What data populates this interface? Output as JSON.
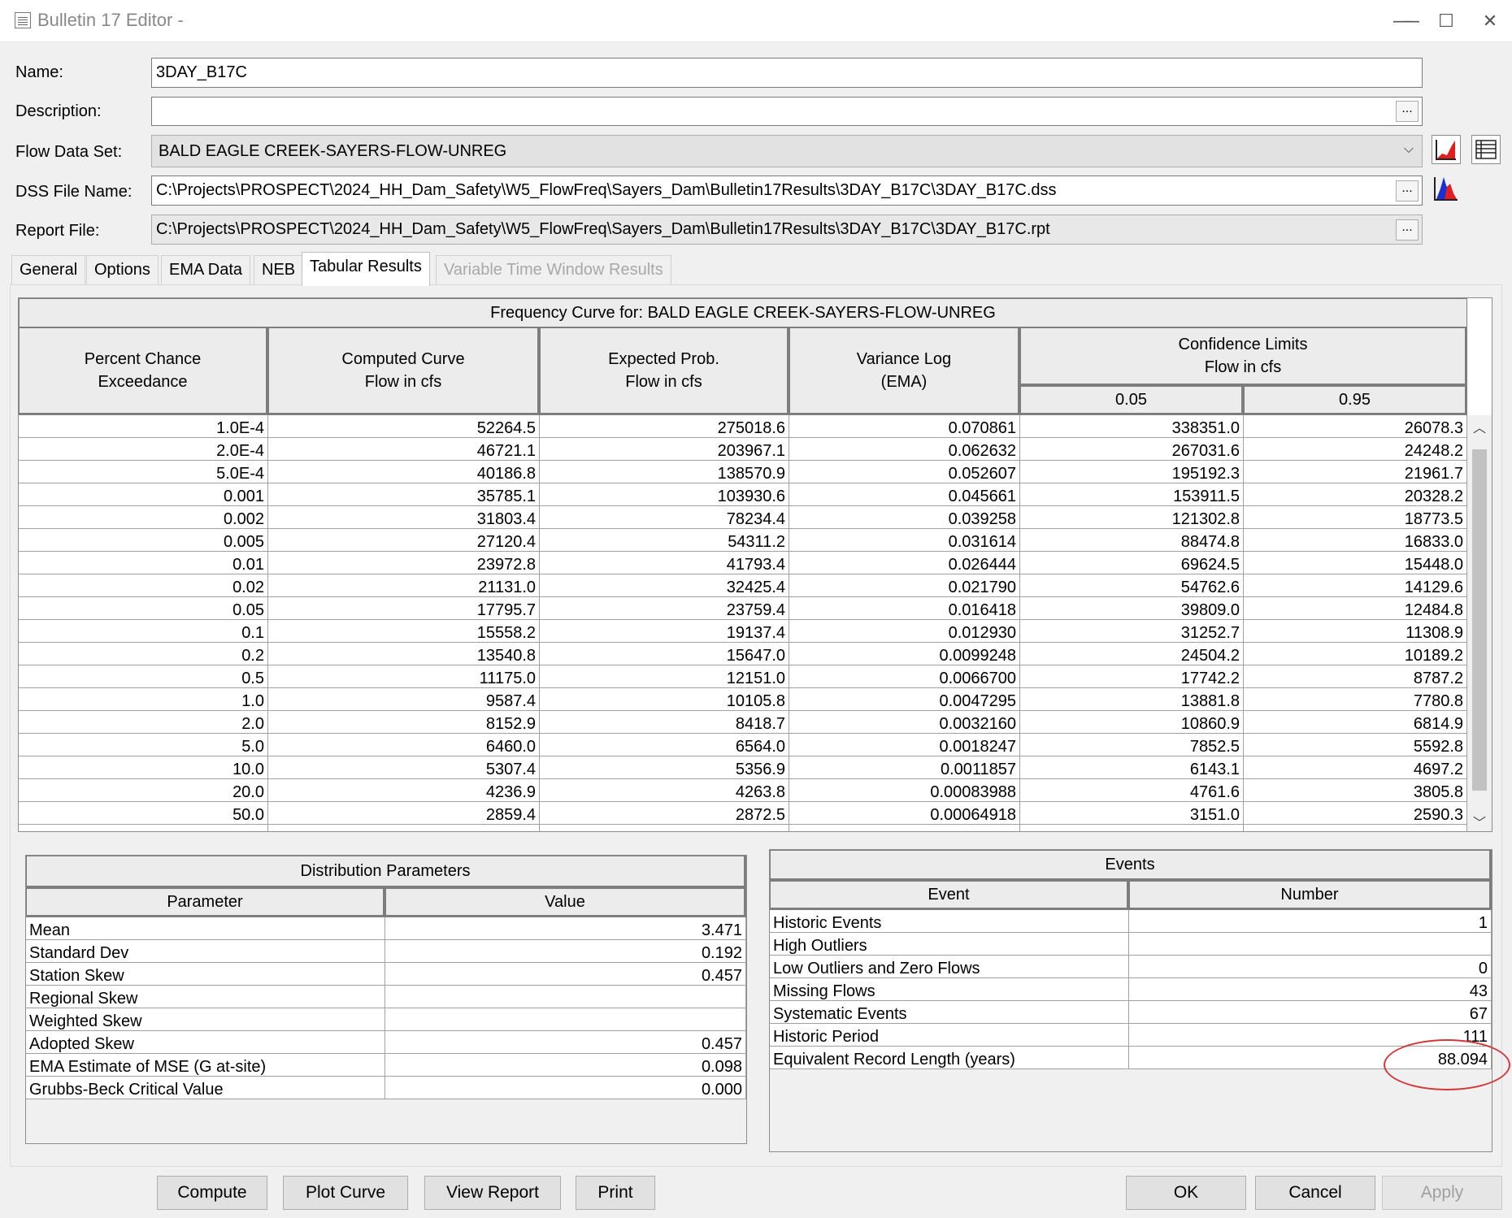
{
  "window": {
    "title": "Bulletin 17 Editor -"
  },
  "form": {
    "name_label": "Name:",
    "name_value": "3DAY_B17C",
    "description_label": "Description:",
    "description_value": "",
    "flow_label": "Flow Data Set:",
    "flow_value": "BALD EAGLE CREEK-SAYERS-FLOW-UNREG",
    "dss_label": "DSS File Name:",
    "dss_value": "C:\\Projects\\PROSPECT\\2024_HH_Dam_Safety\\W5_FlowFreq\\Sayers_Dam\\Bulletin17Results\\3DAY_B17C\\3DAY_B17C.dss",
    "report_label": "Report File:",
    "report_value": "C:\\Projects\\PROSPECT\\2024_HH_Dam_Safety\\W5_FlowFreq\\Sayers_Dam\\Bulletin17Results\\3DAY_B17C\\3DAY_B17C.rpt",
    "ellipsis": "..."
  },
  "tabs": [
    "General",
    "Options",
    "EMA Data",
    "NEB",
    "Tabular Results",
    "Variable Time Window Results"
  ],
  "frequency_table": {
    "title": "Frequency Curve for: BALD EAGLE CREEK-SAYERS-FLOW-UNREG",
    "headers": {
      "percent": [
        "Percent Chance",
        "Exceedance"
      ],
      "computed": [
        "Computed Curve",
        "Flow in cfs"
      ],
      "expected": [
        "Expected Prob.",
        "Flow in cfs"
      ],
      "variance": [
        "Variance Log",
        "(EMA)"
      ],
      "confidence": [
        "Confidence Limits",
        "Flow in cfs"
      ],
      "ci_low": "0.05",
      "ci_high": "0.95"
    },
    "rows": [
      [
        "1.0E-4",
        "52264.5",
        "275018.6",
        "0.070861",
        "338351.0",
        "26078.3"
      ],
      [
        "2.0E-4",
        "46721.1",
        "203967.1",
        "0.062632",
        "267031.6",
        "24248.2"
      ],
      [
        "5.0E-4",
        "40186.8",
        "138570.9",
        "0.052607",
        "195192.3",
        "21961.7"
      ],
      [
        "0.001",
        "35785.1",
        "103930.6",
        "0.045661",
        "153911.5",
        "20328.2"
      ],
      [
        "0.002",
        "31803.4",
        "78234.4",
        "0.039258",
        "121302.8",
        "18773.5"
      ],
      [
        "0.005",
        "27120.4",
        "54311.2",
        "0.031614",
        "88474.8",
        "16833.0"
      ],
      [
        "0.01",
        "23972.8",
        "41793.4",
        "0.026444",
        "69624.5",
        "15448.0"
      ],
      [
        "0.02",
        "21131.0",
        "32425.4",
        "0.021790",
        "54762.6",
        "14129.6"
      ],
      [
        "0.05",
        "17795.7",
        "23759.4",
        "0.016418",
        "39809.0",
        "12484.8"
      ],
      [
        "0.1",
        "15558.2",
        "19137.4",
        "0.012930",
        "31252.7",
        "11308.9"
      ],
      [
        "0.2",
        "13540.8",
        "15647.0",
        "0.0099248",
        "24504.2",
        "10189.2"
      ],
      [
        "0.5",
        "11175.0",
        "12151.0",
        "0.0066700",
        "17742.2",
        "8787.2"
      ],
      [
        "1.0",
        "9587.4",
        "10105.8",
        "0.0047295",
        "13881.8",
        "7780.8"
      ],
      [
        "2.0",
        "8152.9",
        "8418.7",
        "0.0032160",
        "10860.9",
        "6814.9"
      ],
      [
        "5.0",
        "6460.0",
        "6564.0",
        "0.0018247",
        "7852.5",
        "5592.8"
      ],
      [
        "10.0",
        "5307.4",
        "5356.9",
        "0.0011857",
        "6143.1",
        "4697.2"
      ],
      [
        "20.0",
        "4236.9",
        "4263.8",
        "0.00083988",
        "4761.6",
        "3805.8"
      ],
      [
        "50.0",
        "2859.4",
        "2872.5",
        "0.00064918",
        "3151.0",
        "2590.3"
      ]
    ]
  },
  "distribution": {
    "title": "Distribution Parameters",
    "col_param": "Parameter",
    "col_value": "Value",
    "rows": [
      [
        "Mean",
        "3.471"
      ],
      [
        "Standard Dev",
        "0.192"
      ],
      [
        "Station Skew",
        "0.457"
      ],
      [
        "Regional Skew",
        ""
      ],
      [
        "Weighted Skew",
        ""
      ],
      [
        "Adopted Skew",
        "0.457"
      ],
      [
        "EMA Estimate of MSE (G at-site)",
        "0.098"
      ],
      [
        "Grubbs-Beck Critical Value",
        "0.000"
      ]
    ]
  },
  "events": {
    "title": "Events",
    "col_event": "Event",
    "col_number": "Number",
    "rows": [
      [
        "Historic Events",
        "1"
      ],
      [
        "High Outliers",
        ""
      ],
      [
        "Low Outliers and Zero Flows",
        "0"
      ],
      [
        "Missing Flows",
        "43"
      ],
      [
        "Systematic Events",
        "67"
      ],
      [
        "Historic Period",
        "111"
      ],
      [
        "Equivalent Record Length (years)",
        "88.094"
      ]
    ]
  },
  "buttons": {
    "compute": "Compute",
    "plot_curve": "Plot Curve",
    "view_report": "View Report",
    "print": "Print",
    "ok": "OK",
    "cancel": "Cancel",
    "apply": "Apply"
  },
  "colors": {
    "highlight": "#d23a3a",
    "window_bg": "#f0f0f0",
    "header_bg": "#ececec"
  }
}
